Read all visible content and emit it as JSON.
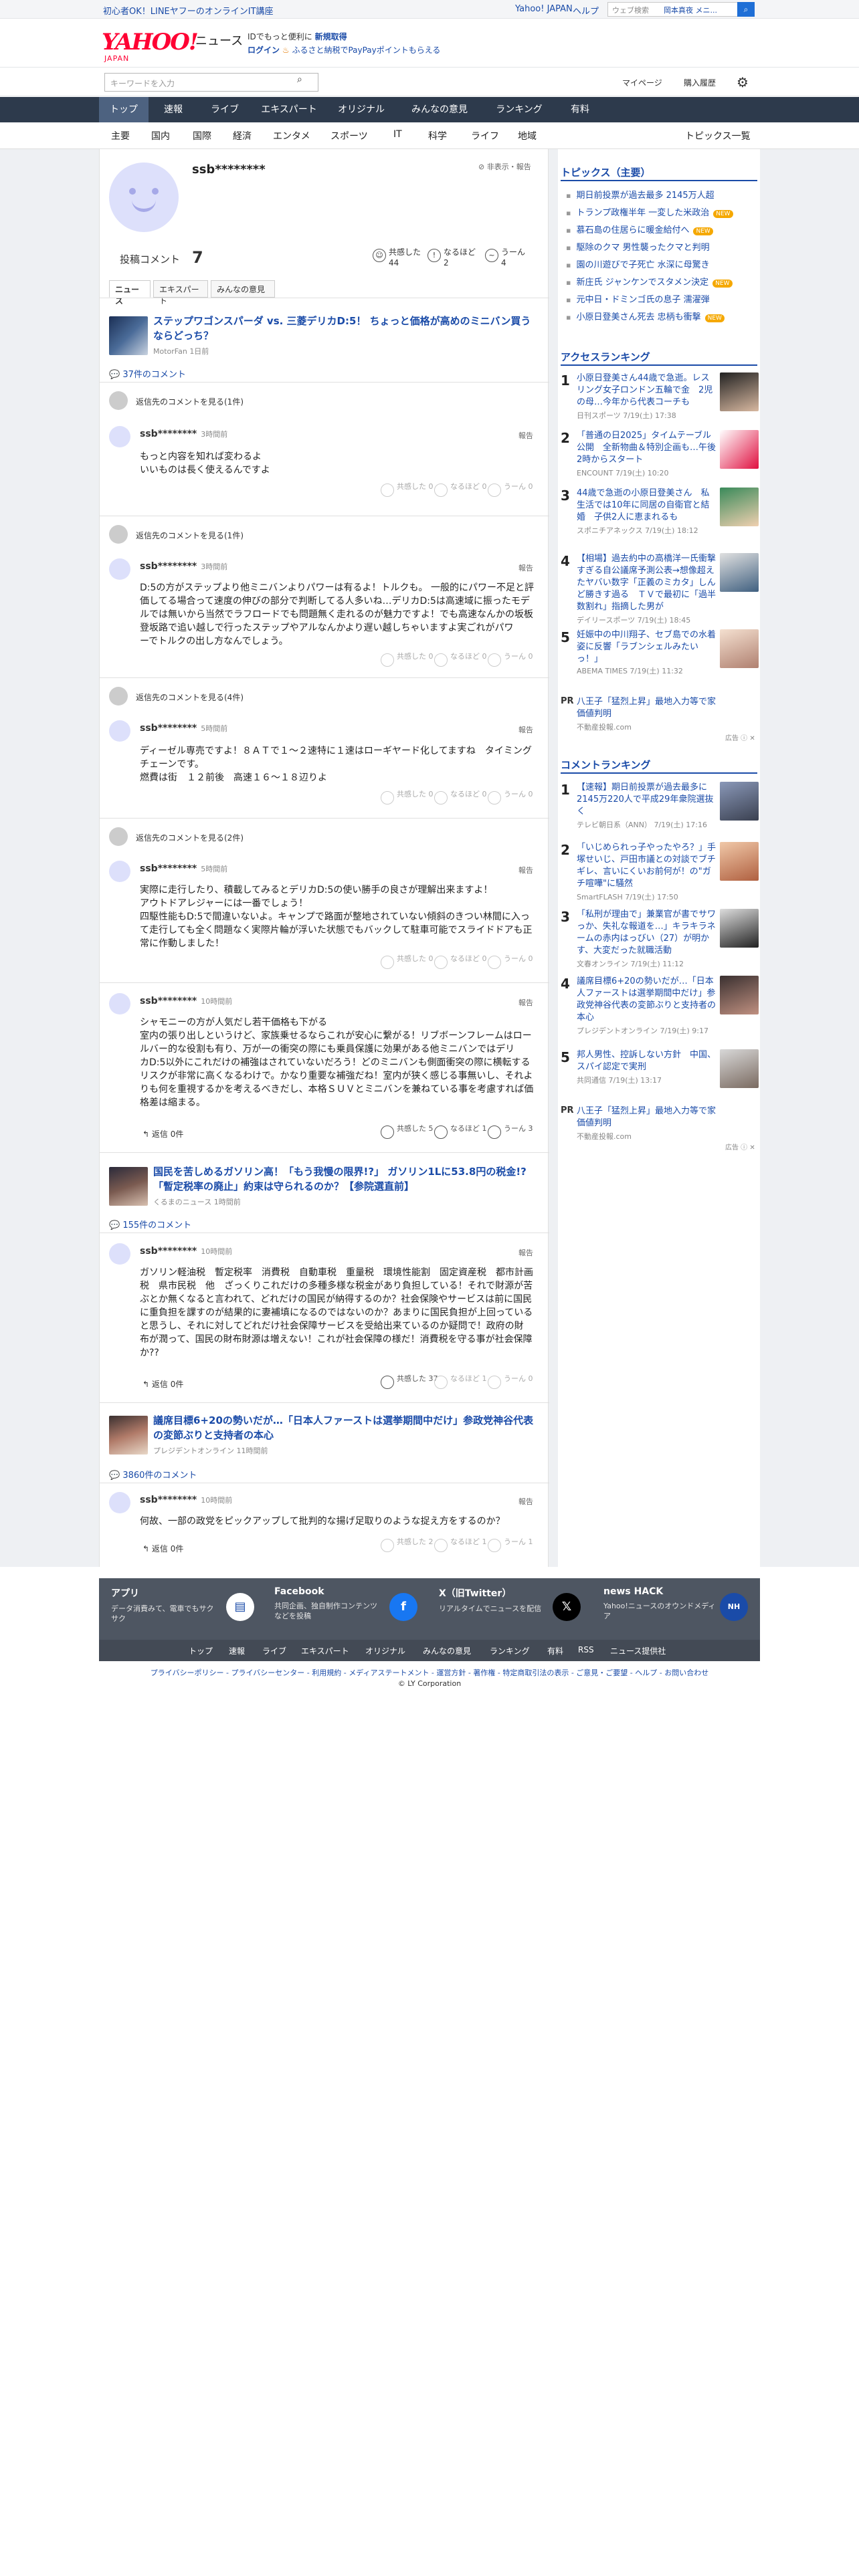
{
  "topbar": {
    "promo": "初心者OK！LINEヤフーのオンラインIT講座",
    "links": [
      "Yahoo! JAPAN",
      "ヘルプ"
    ],
    "search_placeholder": "ウェブ検索",
    "search_chip": "岡本真夜 メニ..."
  },
  "header": {
    "logo": "YAHOO!",
    "logo_sub": "JAPAN",
    "service": "ニュース",
    "line1_pre": "IDでもっと便利に",
    "line1_link": "新規取得",
    "line2_login": "ログイン",
    "line2_rest": "ふるさと納税でPayPayポイントもらえる"
  },
  "search": {
    "placeholder": "キーワードを入力",
    "mypage": "マイページ",
    "history": "購入履歴"
  },
  "gnav": [
    "トップ",
    "速報",
    "ライブ",
    "エキスパート",
    "オリジナル",
    "みんなの意見",
    "ランキング",
    "有料"
  ],
  "subnav": [
    "主要",
    "国内",
    "国際",
    "経済",
    "エンタメ",
    "スポーツ",
    "IT",
    "科学",
    "ライフ",
    "地域"
  ],
  "subnav_all": "トピックス一覧",
  "profile": {
    "username": "ssb********",
    "report": "非表示・報告",
    "posted_label": "投稿コメント",
    "posted_count": "7",
    "reactions": [
      {
        "label": "共感した",
        "count": "44"
      },
      {
        "label": "なるほど",
        "count": "2"
      },
      {
        "label": "うーん",
        "count": "4"
      }
    ],
    "tabs": [
      "ニュース",
      "エキスパート",
      "みんなの意見"
    ]
  },
  "articles": [
    {
      "title": "ステップワゴンスパーダ vs. 三菱デリカD:5！ ちょっと価格が高めのミニバン買うならどっち？",
      "source": "MotorFan 1日前",
      "comments": "37件のコメント",
      "comment_blocks": [
        {
          "reply": "返信先のコメントを見る(1件)",
          "name": "ssb********",
          "time": "3時間前",
          "report": "報告",
          "lines": [
            "もっと内容を知れば変わるよ",
            "いいものは長く使えるんですよ"
          ],
          "r": [
            "共感した 0",
            "なるほど 0",
            "うーん 0"
          ]
        },
        {
          "reply": "返信先のコメントを見る(1件)",
          "name": "ssb********",
          "time": "3時間前",
          "report": "報告",
          "lines": [
            "D:5の方がステップより他ミニバンよりパワーは有るよ！トルクも。 一般的にパワー不足と評",
            "価してる場合って速度の伸びの部分で判断してる人多いね…デリカD:5は高速域に振ったモデ",
            "ルでは無いから当然でラフロードでも問題無く走れるのが魅力ですよ！でも高速なんかの坂板",
            "登坂路で追い越しで行ったステップやアルなんかより遅い越しちゃいますよ実ごれがパワ",
            "ーでトルクの出し方なんでしょう。"
          ],
          "r": [
            "共感した 0",
            "なるほど 0",
            "うーん 0"
          ]
        },
        {
          "reply": "返信先のコメントを見る(4件)",
          "name": "ssb********",
          "time": "5時間前",
          "report": "報告",
          "lines": [
            "ディーゼル専売ですよ！８ＡＴで１〜２速特に１速はローギヤード化してますね　タイミング",
            "チェーンです。",
            "燃費は街　１２前後　高速１６〜１８辺りよ"
          ],
          "r": [
            "共感した 0",
            "なるほど 0",
            "うーん 0"
          ]
        },
        {
          "reply": "返信先のコメントを見る(2件)",
          "name": "ssb********",
          "time": "5時間前",
          "report": "報告",
          "lines": [
            "実際に走行したり、積載してみるとデリカD:5の使い勝手の良さが理解出来ますよ！",
            "アウトドアレジャーには一番でしょう！",
            "四駆性能もD:5で間違いないよ。キャンプで路面が整地されていない傾斜のきつい林間に入っ",
            "て走行しても全く問題なく実際片輪が浮いた状態でもバックして駐車可能でスライドドアも正",
            "常に作動しました！"
          ],
          "r": [
            "共感した 0",
            "なるほど 0",
            "うーん 0"
          ]
        },
        {
          "reply": "",
          "name": "ssb********",
          "time": "10時間前",
          "report": "報告",
          "lines": [
            "シャモニーの方が人気だし若干価格も下がる",
            "室内の張り出しというけど、家族乗せるならこれが安心に繋がる！リブボーンフレームはロー",
            "ルバー的な役割も有り、万が一の衝突の際にも乗員保護に効果がある他ミニバンではデリ",
            "カD:5以外にこれだけの補強はされていないだろう！どのミニバンも側面衝突の際に横転する",
            "リスクが非常に高くなるわけで。かなり重要な補強だね！室内が狭く感じる事無いし、それよ",
            "りも何を重視するかを考えるべきだし、本格ＳＵＶとミニバンを兼ねている事を考慮すれば価",
            "格差は縮まる。"
          ],
          "r": [
            "共感した 5",
            "なるほど 1",
            "うーん 3"
          ],
          "reply_label": "返信 0件"
        }
      ]
    },
    {
      "title": "国民を苦しめるガソリン高！「もう我慢の限界!?」 ガソリン1Lに53.8円の税金!? 「暫定税率の廃止」約束は守られるのか？【参院選直前】",
      "source": "くるまのニュース 1時間前",
      "comments": "155件のコメント",
      "comment_blocks": [
        {
          "reply": "",
          "name": "ssb********",
          "time": "10時間前",
          "report": "報告",
          "lines": [
            "ガソリン軽油税　暫定税率　消費税　自動車税　重量税　環境性能割　固定資産税　都市計画",
            "税　県市民税　他　ざっくりこれだけの多種多様な税金があり負担している！それで財源が苦",
            "ぶとか無くなると言われて、どれだけの国民が納得するのか？社会保険やサービスは前に国民",
            "に重負担を課すのが結果的に妻補填になるのではないのか？あまりに国民負担が上回っている",
            "と思うし、それに対してどれだけ社会保障サービスを受給出来ているのか疑問で！政府の財",
            "布が潤って、国民の財布財源は増えない！これが社会保障の様だ！消費税を守る事が社会保障",
            "か??"
          ],
          "r": [
            "共感した 37",
            "なるほど 1",
            "うーん 0"
          ],
          "reply_label": "返信 0件"
        }
      ]
    },
    {
      "title": "議席目標6+20の勢いだが…「日本人ファーストは選挙期間中だけ」参政党神谷代表の変節ぶりと支持者の本心",
      "source": "プレジデントオンライン 11時間前",
      "comments": "3860件のコメント",
      "comment_blocks": [
        {
          "reply": "",
          "name": "ssb********",
          "time": "10時間前",
          "report": "報告",
          "lines": [
            "何故、一部の政党をピックアップして批判的な揚げ足取りのような捉え方をするのか？"
          ],
          "r": [
            "共感した 2",
            "なるほど 1",
            "うーん 1"
          ],
          "reply_label": "返信 0件"
        }
      ]
    }
  ],
  "sidebar": {
    "topics_title": "トピックス（主要）",
    "topics": [
      {
        "t": "期日前投票が過去最多 2145万人超",
        "b": ""
      },
      {
        "t": "トランプ政権半年 一変した米政治",
        "b": "NEW"
      },
      {
        "t": "慕石島の住居らに暖金給付へ",
        "b": "NEW"
      },
      {
        "t": "駆除のクマ 男性襲ったクマと判明",
        "b": ""
      },
      {
        "t": "園の川遊びで子死亡 水深に母驚き",
        "b": ""
      },
      {
        "t": "新庄氏 ジャンケンでスタメン決定",
        "b": "NEW"
      },
      {
        "t": "元中日・ドミンゴ氏の息子 濡濯弾",
        "b": ""
      },
      {
        "t": "小原日登美さん死去 忠柄も衝撃",
        "b": "NEW"
      }
    ],
    "access_title": "アクセスランキング",
    "access": [
      {
        "n": "1",
        "t": "小原日登美さん44歳で急逝。レスリング女子ロンドン五輪で金　2児の母…今年から代表コーチも",
        "s": "日刊スポーツ 7/19(土) 17:38"
      },
      {
        "n": "2",
        "t": "「普通の日2025」タイムテーブル公開　全新物曲＆特別企画も…午後2時からスタート",
        "s": "ENCOUNT 7/19(土) 10:20"
      },
      {
        "n": "3",
        "t": "44歳で急逝の小原日登美さん　私生活では10年に同居の自衛官と結婚　子供2人に恵まれるも",
        "s": "スポニチアネックス 7/19(土) 18:12"
      },
      {
        "n": "4",
        "t": "【相場】過去約中の高橋洋一氏衝撃すぎる自公議席予測公表→想像超えたヤバい数字「正義のミカタ」しんど勝きす過る　ＴＶで最初に「過半数割れ」指摘した男が",
        "s": "デイリースポーツ 7/19(土) 18:45"
      },
      {
        "n": "5",
        "t": "妊娠中の中川翔子、セブ島での水着姿に反響「ラブンシェルみたいっ！」",
        "s": "ABEMA TIMES 7/19(土) 11:32"
      }
    ],
    "pr1": {
      "t": "八王子「猛烈上昇」最地入力等で家価値判明",
      "s": "不動産投報.com"
    },
    "comment_title": "コメントランキング",
    "cranks": [
      {
        "n": "1",
        "t": "【速報】期日前投票が過去最多に2145万220人で平成29年衆院選抜く",
        "s": "テレビ朝日系（ANN） 7/19(土) 17:16"
      },
      {
        "n": "2",
        "t": "「いじめられっ子やったやろ？」手塚せいじ、戸田市議との対談でブチギレ、言いにくいお前何が！の\"ガチ喧嘩\"に騒然",
        "s": "SmartFLASH 7/19(土) 17:50"
      },
      {
        "n": "3",
        "t": "「私刑が理由で」兼業官が書でサワっか、失礼な報道を…」キラキラネームの赤内はっびい（27）が明かす、大変だった就職活動",
        "s": "文春オンライン 7/19(土) 11:12"
      },
      {
        "n": "4",
        "t": "議席目標6+20の勢いだが…「日本人ファーストは選挙期間中だけ」参政党神谷代表の変節ぶりと支持者の本心",
        "s": "プレジデントオンライン 7/19(土) 9:17"
      },
      {
        "n": "5",
        "t": "邦人男性、控訴しない方針　中国、スパイ認定で実刑",
        "s": "共同通信 7/19(土) 13:17"
      }
    ],
    "pr2": {
      "t": "八王子「猛烈上昇」最地入力等で家価値判明",
      "s": "不動産投報.com"
    },
    "ad": "広告"
  },
  "footer": {
    "cols": [
      {
        "h": "アプリ",
        "d": "データ消費みて、電車でもサクサク"
      },
      {
        "h": "Facebook",
        "d": "共同企画、独自制作コンテンツなどを投稿"
      },
      {
        "h": "X（旧Twitter）",
        "d": "リアルタイムでニュースを配信"
      },
      {
        "h": "news HACK",
        "d": "Yahoo!ニュースのオウンドメディア"
      }
    ],
    "links": [
      "トップ",
      "速報",
      "ライブ",
      "エキスパート",
      "オリジナル",
      "みんなの意見",
      "ランキング",
      "有料",
      "RSS",
      "ニュース提供社"
    ],
    "legal": "プライバシーポリシー - プライバシーセンター - 利用規約 - メディアステートメント - 運営方針 - 著作権 - 特定商取引法の表示 - ご意見・ご要望 - ヘルプ - お問い合わせ",
    "copyright": "© LY Corporation"
  }
}
